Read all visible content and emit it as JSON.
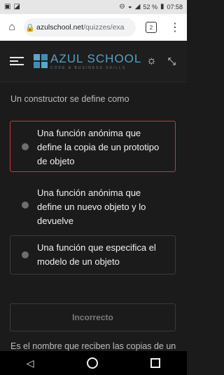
{
  "status_bar": {
    "battery": "52 %",
    "time": "07:58"
  },
  "browser": {
    "url_domain": "azulschool.net",
    "url_path": "/quizzes/exa",
    "tab_count": "2"
  },
  "header": {
    "logo_main": "AZUL SCHOOL",
    "logo_sub": "CODE & BUSINESS SKILLS"
  },
  "quiz": {
    "question": "Un constructor se define como",
    "options": [
      {
        "label": "Una función anónima que define la copia de un prototipo de objeto",
        "selected": true
      },
      {
        "label": "Una función anónima que define un nuevo objeto y lo devuelve",
        "selected": false
      },
      {
        "label": "Una función que especifica el modelo de un objeto",
        "selected": false
      }
    ],
    "result_label": "Incorrecto",
    "next_question": "Es el nombre que reciben las copias de un"
  },
  "colors": {
    "accent": "#4fa3c8",
    "error_border": "#c9373c",
    "background": "#1b1b1b"
  },
  "icons": {
    "home": "home-icon",
    "lock": "lock-icon",
    "menu": "hamburger-icon",
    "theme": "sun-icon",
    "collapse": "collapse-icon"
  }
}
